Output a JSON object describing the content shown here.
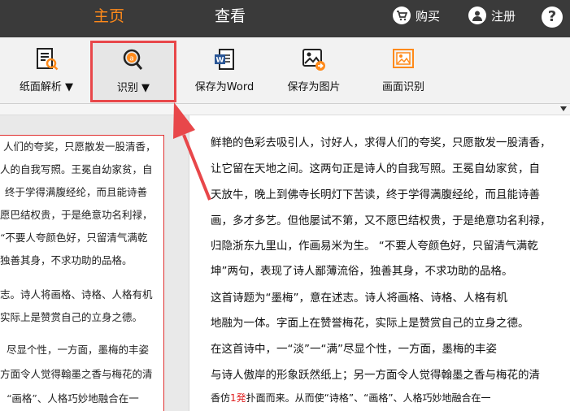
{
  "topbar": {
    "tabs": [
      {
        "label": "主页",
        "active": true
      },
      {
        "label": "查看",
        "active": false
      }
    ],
    "buy_label": "购买",
    "register_label": "注册",
    "help_label": "?"
  },
  "toolbar": {
    "items": [
      {
        "label": "纸面解析 ▼",
        "icon": "document-analysis-icon"
      },
      {
        "label": "识别 ▼",
        "icon": "recognize-magnifier-icon",
        "selected": true
      },
      {
        "label": "保存为Word",
        "icon": "word-doc-icon"
      },
      {
        "label": "保存为图片",
        "icon": "save-image-icon"
      },
      {
        "label": "画面识别",
        "icon": "screen-capture-icon"
      }
    ]
  },
  "left_page": {
    "lines": [
      "人们的夸奖，只愿散发一股清香，",
      "人的自我写照。王冕自幼家贫，自",
      "终于学得满腹经纶，而且能诗善",
      "愿巴结权贵，于是绝意功名利禄，",
      "“不要人夸颜色好，只留清气满乾",
      "独善其身，不求功助的品格。",
      "志。诗人将画格、诗格、人格有机",
      "实际上是赞赏自己的立身之德。",
      "尽显个性，一方面，墨梅的丰姿",
      "方面令人觉得翰墨之香与梅花的清",
      "“画格”、人格巧妙地融合在一"
    ]
  },
  "right_page": {
    "lines": [
      "鲜艳的色彩去吸引人，讨好人，求得人们的夸奖，只愿散发一股清香，",
      "让它留在天地之间。这两句正是诗人的自我写照。王冕自幼家贫，自",
      "天放牛，晚上到佛寺长明灯下苦读，终于学得满腹经纶，而且能诗善",
      "画，多才多艺。但他屡试不第，又不愿巴结权贵，于是绝意功名利禄，",
      "归隐浙东九里山，作画易米为生。  “不要人夸颜色好，只留清气满乾",
      "坤”两句，表现了诗人鄙薄流俗，独善其身，不求功助的品格。",
      "    这首诗题为“墨梅”，意在述志。诗人将画格、诗格、人格有机",
      "地融为一体。字面上在赞誉梅花，实际上是赞赏自己的立身之德。",
      "    在这首诗中，一“淡”一“满”尽显个性，一方面，墨梅的丰姿",
      "与诗人傲岸的形象跃然纸上；另一方面令人觉得翰墨之香与梅花的清",
      "香仿"
    ],
    "last_red": "1",
    "last_red_char": "発",
    "last_tail": "扑面而来。从而使“诗格”、“画格”、人格巧妙地融合在一"
  }
}
